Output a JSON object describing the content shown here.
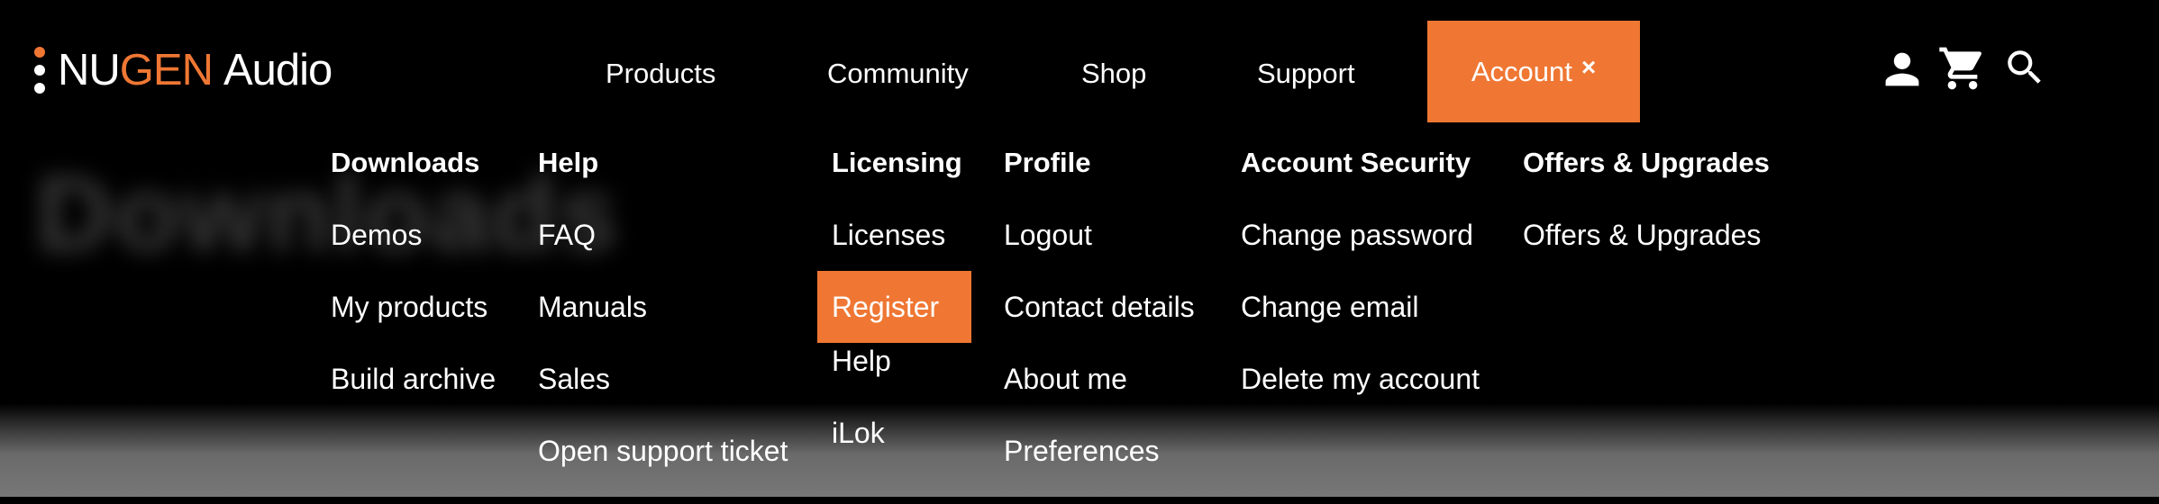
{
  "bg_title": "Downloads",
  "brand": {
    "part1": "NU",
    "part2": "GEN",
    "part3": "Audio",
    "accent": "#ef7733"
  },
  "nav": {
    "products": "Products",
    "community": "Community",
    "shop": "Shop",
    "support": "Support",
    "account": "Account",
    "close_glyph": "×"
  },
  "icons": {
    "user": "user-icon",
    "cart": "cart-icon",
    "search": "search-icon"
  },
  "menu": [
    {
      "heading": "Downloads",
      "links": [
        "Demos",
        "My products",
        "Build archive"
      ]
    },
    {
      "heading": "Help",
      "links": [
        "FAQ",
        "Manuals",
        "Sales",
        "Open support ticket"
      ]
    },
    {
      "heading": "Licensing",
      "links": [
        "Licenses",
        "Register",
        "Help",
        "iLok"
      ],
      "active": "Register"
    },
    {
      "heading": "Profile",
      "links": [
        "Logout",
        "Contact details",
        "About me",
        "Preferences"
      ]
    },
    {
      "heading": "Account Security",
      "links": [
        "Change password",
        "Change email",
        "Delete my account"
      ]
    },
    {
      "heading": "Offers & Upgrades",
      "links": [
        "Offers & Upgrades"
      ]
    }
  ]
}
